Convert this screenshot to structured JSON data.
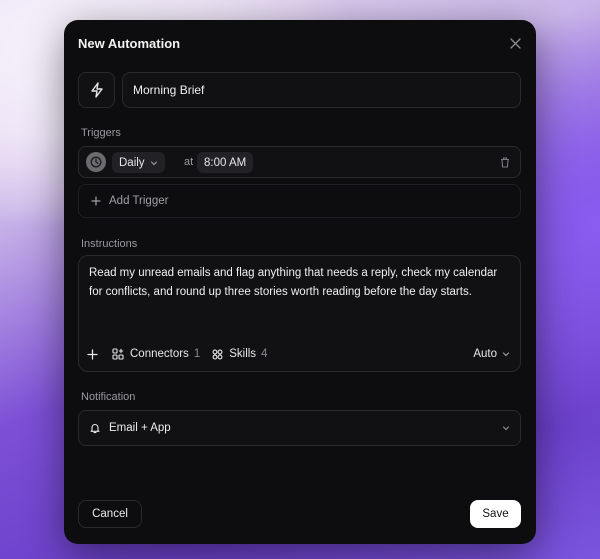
{
  "modal": {
    "title": "New Automation",
    "close_icon": "close-icon",
    "automation_icon": "lightning-bolt-icon",
    "name_value": "Morning Brief"
  },
  "triggers": {
    "label": "Triggers",
    "items": [
      {
        "icon": "clock-icon",
        "frequency": "Daily",
        "at_text": "at",
        "time": "8:00 AM",
        "delete_icon": "trash-icon"
      }
    ],
    "add_label": "Add Trigger"
  },
  "instructions": {
    "label": "Instructions",
    "text": "Read my unread emails and flag anything that needs a reply, check my calendar for conflicts, and round up three stories worth reading before the day starts.",
    "connectors_label": "Connectors",
    "connectors_count": "1",
    "skills_label": "Skills",
    "skills_count": "4",
    "model_label": "Auto"
  },
  "notification": {
    "label": "Notification",
    "value": "Email + App",
    "icon": "bell-icon"
  },
  "footer": {
    "cancel_label": "Cancel",
    "save_label": "Save"
  },
  "colors": {
    "modal_bg": "#0d0c0e",
    "field_bg": "#111013",
    "border": "#2a2a2d",
    "muted_text": "#9a9aa0",
    "save_bg": "#ffffff"
  }
}
